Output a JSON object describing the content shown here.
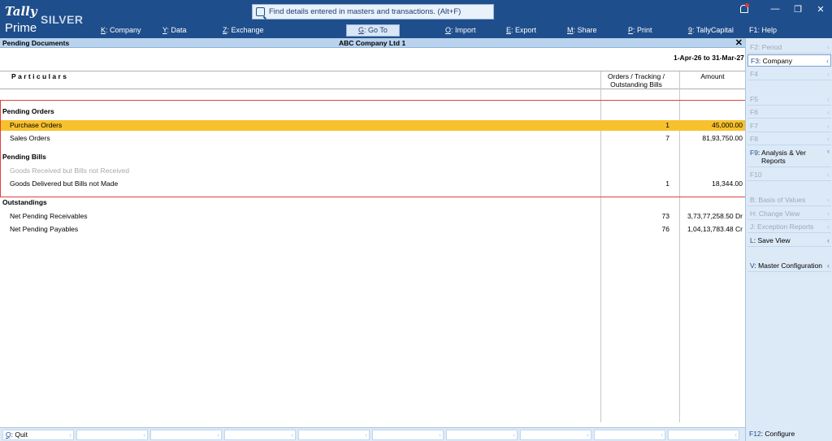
{
  "app": {
    "logo_brand": "Tally",
    "logo_edition": "SILVER",
    "logo_product": "Prime",
    "search_placeholder": "Find details entered in masters and transactions. (Alt+F)"
  },
  "menu": [
    {
      "key": "K",
      "label": ": Company"
    },
    {
      "key": "Y",
      "label": ": Data"
    },
    {
      "key": "Z",
      "label": ": Exchange"
    },
    {
      "key": "G",
      "label": ": Go To"
    },
    {
      "key": "O",
      "label": ": Import"
    },
    {
      "key": "E",
      "label": ": Export"
    },
    {
      "key": "M",
      "label": ": Share"
    },
    {
      "key": "P",
      "label": ": Print"
    },
    {
      "key": "9",
      "label": ": TallyCapital"
    },
    {
      "key": "F1",
      "label": ": Help"
    }
  ],
  "report": {
    "title": "Pending Documents",
    "company": "ABC Company Ltd 1",
    "period": "1-Apr-26 to 31-Mar-27",
    "close": "✕",
    "col_particulars": "Particulars",
    "col_orders_line1": "Orders / Tracking /",
    "col_orders_line2": "Outstanding Bills",
    "col_amount": "Amount"
  },
  "rows": [
    {
      "type": "group",
      "label": "Pending Orders",
      "count": "",
      "amount": ""
    },
    {
      "type": "sub",
      "label": "Purchase Orders",
      "count": "1",
      "amount": "45,000.00",
      "selected": true
    },
    {
      "type": "sub",
      "label": "Sales Orders",
      "count": "7",
      "amount": "81,93,750.00"
    },
    {
      "type": "group",
      "label": "Pending Bills",
      "count": "",
      "amount": ""
    },
    {
      "type": "sub",
      "label": "Goods Received but Bills not Received",
      "count": "",
      "amount": "",
      "dim": true
    },
    {
      "type": "sub",
      "label": "Goods Delivered but Bills not Made",
      "count": "1",
      "amount": "18,344.00"
    },
    {
      "type": "group",
      "label": "Outstandings",
      "count": "",
      "amount": ""
    },
    {
      "type": "sub",
      "label": "Net Pending Receivables",
      "count": "73",
      "amount": "3,73,77,258.50 Dr"
    },
    {
      "type": "sub",
      "label": "Net Pending Payables",
      "count": "76",
      "amount": "1,04,13,783.48 Cr"
    }
  ],
  "right_panel": [
    {
      "key": "F2",
      "label": ": Period",
      "disabled": true
    },
    {
      "key": "F3",
      "label": ": Company",
      "active": true
    },
    {
      "key": "F4",
      "label": "",
      "disabled": true
    },
    {
      "key": "F5",
      "label": "",
      "disabled": true
    },
    {
      "key": "F6",
      "label": "",
      "disabled": true
    },
    {
      "key": "F7",
      "label": "",
      "disabled": true
    },
    {
      "key": "F8",
      "label": "",
      "disabled": true
    },
    {
      "key": "F9",
      "label": ": Analysis & Ver",
      "label2": "Reports"
    },
    {
      "key": "F10",
      "label": "",
      "disabled": true
    },
    {
      "key": "B",
      "label": ": Basis of Values",
      "disabled": true
    },
    {
      "key": "H",
      "label": ": Change View",
      "disabled": true
    },
    {
      "key": "J",
      "label": ": Exception Reports",
      "disabled": true
    },
    {
      "key": "L",
      "label": ": Save View"
    },
    {
      "key": "V",
      "label": ": Master Configuration"
    }
  ],
  "bottom": {
    "quit_key": "Q",
    "quit_label": ": Quit",
    "configure_key": "F12",
    "configure_label": ": Configure"
  }
}
